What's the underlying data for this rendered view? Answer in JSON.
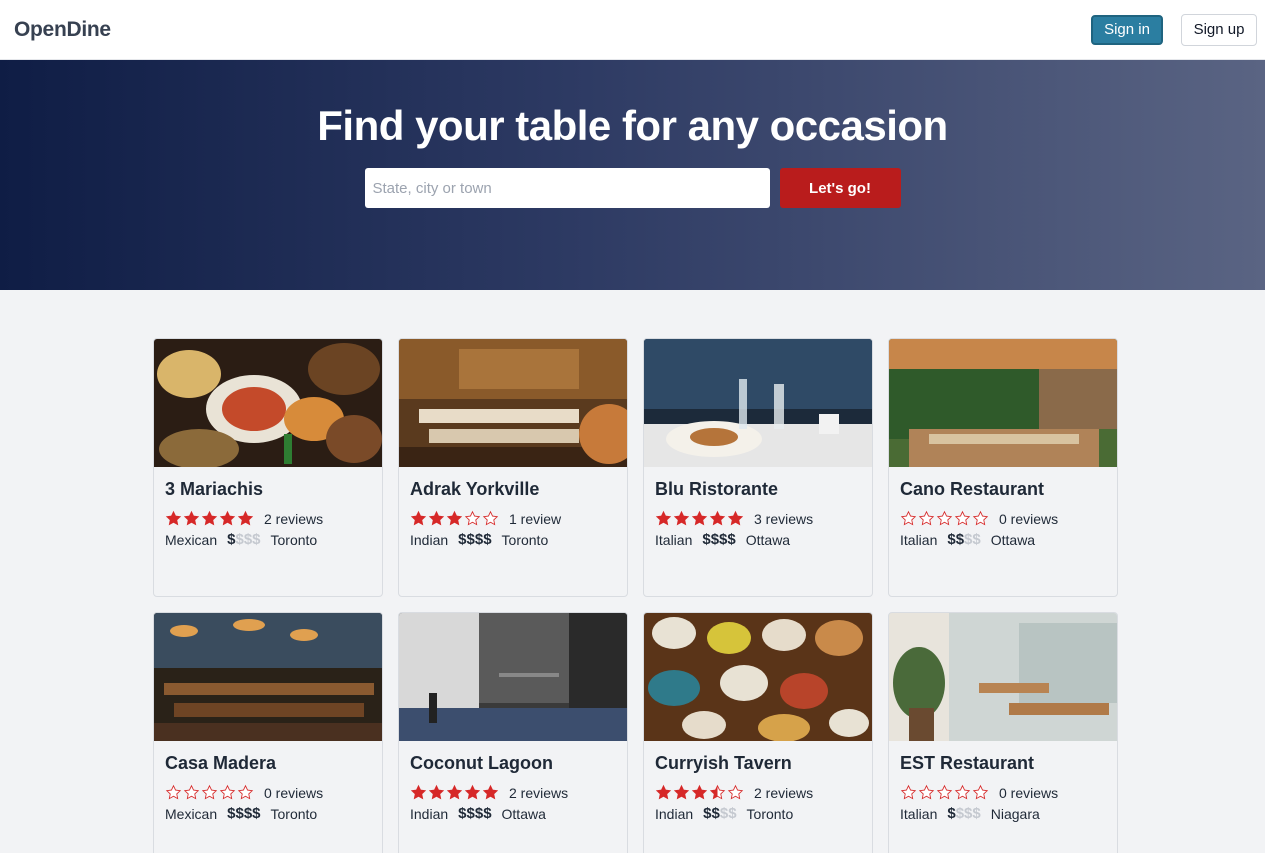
{
  "header": {
    "brand": "OpenDine",
    "signin_label": "Sign in",
    "signup_label": "Sign up"
  },
  "hero": {
    "title": "Find your table for any occasion",
    "search_placeholder": "State, city or town",
    "go_label": "Let's go!"
  },
  "colors": {
    "accent": "#2b7ea1",
    "cta": "#b91c1c",
    "star": "#d62828"
  },
  "restaurants": [
    {
      "name": "3 Mariachis",
      "rating": 5,
      "reviews": "2 reviews",
      "cuisine": "Mexican",
      "price": 1,
      "city": "Toronto"
    },
    {
      "name": "Adrak Yorkville",
      "rating": 3,
      "reviews": "1 review",
      "cuisine": "Indian",
      "price": 4,
      "city": "Toronto"
    },
    {
      "name": "Blu Ristorante",
      "rating": 5,
      "reviews": "3 reviews",
      "cuisine": "Italian",
      "price": 4,
      "city": "Ottawa"
    },
    {
      "name": "Cano Restaurant",
      "rating": 0,
      "reviews": "0 reviews",
      "cuisine": "Italian",
      "price": 2,
      "city": "Ottawa"
    },
    {
      "name": "Casa Madera",
      "rating": 0,
      "reviews": "0 reviews",
      "cuisine": "Mexican",
      "price": 4,
      "city": "Toronto"
    },
    {
      "name": "Coconut Lagoon",
      "rating": 5,
      "reviews": "2 reviews",
      "cuisine": "Indian",
      "price": 4,
      "city": "Ottawa"
    },
    {
      "name": "Curryish Tavern",
      "rating": 3.5,
      "reviews": "2 reviews",
      "cuisine": "Indian",
      "price": 2,
      "city": "Toronto"
    },
    {
      "name": "EST Restaurant",
      "rating": 0,
      "reviews": "0 reviews",
      "cuisine": "Italian",
      "price": 1,
      "city": "Niagara"
    }
  ]
}
